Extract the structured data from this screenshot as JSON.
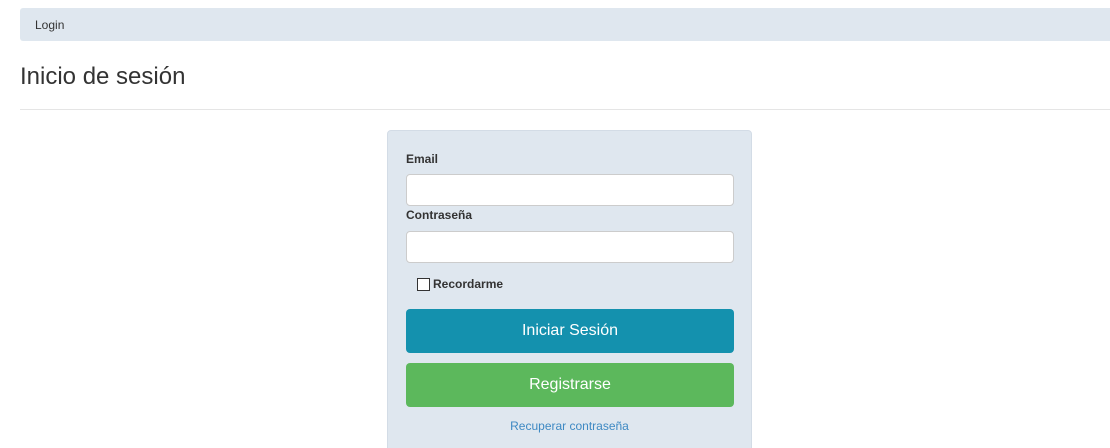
{
  "breadcrumb": {
    "current": "Login"
  },
  "page": {
    "title": "Inicio de sesión"
  },
  "login_form": {
    "email_label": "Email",
    "email_value": "",
    "password_label": "Contraseña",
    "password_value": "",
    "remember_label": "Recordarme",
    "remember_checked": false,
    "login_button": "Iniciar Sesión",
    "register_button": "Registrarse",
    "recover_link": "Recuperar contraseña"
  },
  "colors": {
    "breadcrumb_bg": "#dfe7ef",
    "panel_bg": "#dfe7ef",
    "login_button": "#1491ae",
    "register_button": "#5cb85c",
    "link": "#3e89c3"
  }
}
